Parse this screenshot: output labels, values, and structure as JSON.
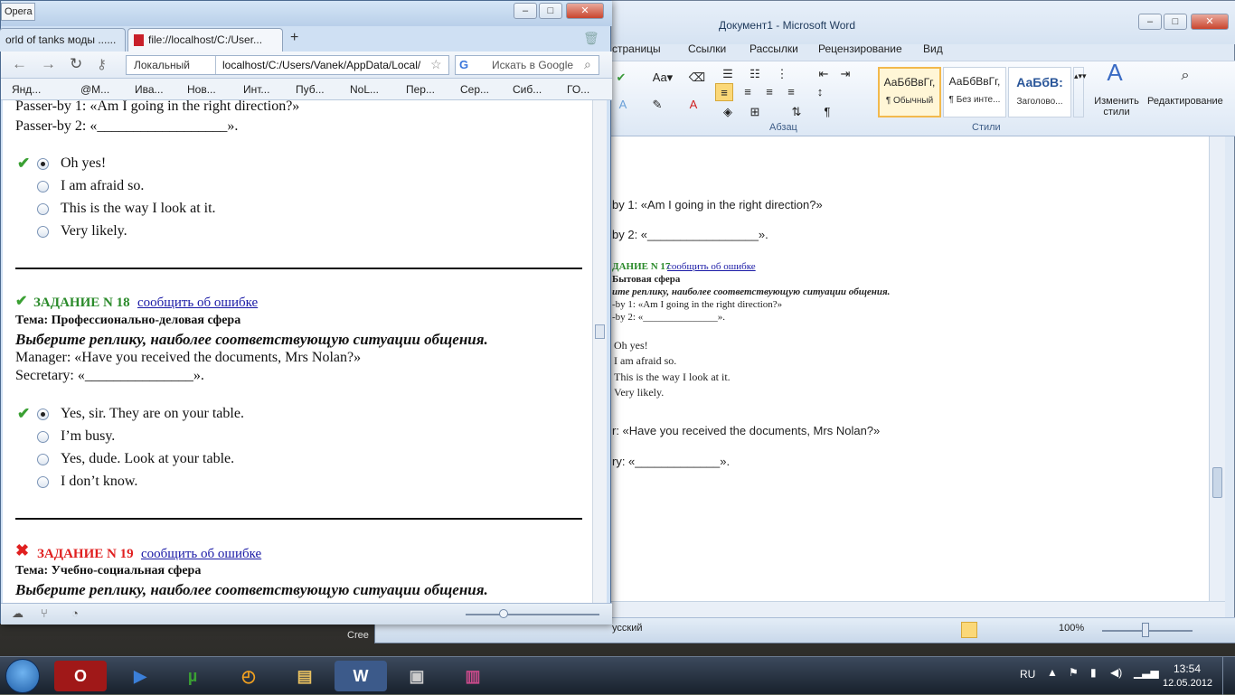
{
  "word": {
    "title": "Документ1 - Microsoft Word",
    "menu": [
      "страницы",
      "Ссылки",
      "Рассылки",
      "Рецензирование",
      "Вид"
    ],
    "styles": [
      {
        "preview": "АаБбВвГг,",
        "name": "¶ Обычный"
      },
      {
        "preview": "АаБбВвГг,",
        "name": "¶ Без инте..."
      },
      {
        "preview": "АаБбВ:",
        "name": "Заголово..."
      }
    ],
    "change_styles": "Изменить стили",
    "editing": "Редактирование",
    "group_paragraph": "Абзац",
    "group_styles": "Стили",
    "doc_lines": [
      "by 1: «Am I going in the right direction?»",
      "by 2: «_________________».",
      "ДАНИЕ N 17",
      "сообщить об ошибке",
      "Бытовая сфера",
      "ите реплику, наиболее соответствующую ситуации общения.",
      "-by 1: «Am I going in the right direction?»",
      "-by 2: «_______________».",
      "Oh yes!",
      "I am afraid so.",
      "This is the way I look at it.",
      "Very likely.",
      "r: «Have you received the documents, Mrs Nolan?»",
      "ry: «_____________»."
    ],
    "language": "усский",
    "zoom": "100%"
  },
  "opera": {
    "badge": "Opera",
    "tabs": [
      "orld of tanks моды ......",
      "file://localhost/C:/User..."
    ],
    "address_label": "Локальный",
    "address": "localhost/C:/Users/Vanek/AppData/Local/",
    "search_placeholder": "Искать в Google",
    "bookmarks": [
      "Янд...",
      "@M...",
      "Ива...",
      "Нов...",
      "Инт...",
      "Пуб...",
      "NoL...",
      "Пер...",
      "Сер...",
      "Сиб...",
      "ГО..."
    ]
  },
  "page": {
    "prev_q1": "Passer-by 1: «Am I going in the right direction?»",
    "prev_q2": "Passer-by 2: «__________________».",
    "prev_options": [
      "Oh yes!",
      "I am afraid so.",
      "This is the way I look at it.",
      "Very likely."
    ],
    "task18_title": "ЗАДАНИЕ N 18",
    "report_link": "сообщить об ошибке",
    "task18_topic": "Тема: Профессионально-деловая сфера",
    "instruction": "Выберите реплику, наиболее соответствующую ситуации общения.",
    "task18_line1": "Manager: «Have you received the documents, Mrs Nolan?»",
    "task18_line2": "Secretary: «_______________».",
    "task18_options": [
      "Yes, sir. They are on your table.",
      "I’m busy.",
      "Yes, dude. Look at your table.",
      "I don’t know."
    ],
    "task19_title": "ЗАДАНИЕ N 19",
    "task19_topic": "Тема: Учебно-социальная сфера",
    "task19_instruction": "Выберите реплику, наиболее соответствующую ситуации общения."
  },
  "taskbar": {
    "lang": "RU",
    "time": "13:54",
    "date": "12.05.2012",
    "behind_text": "Cree"
  },
  "colors": {
    "correct": "#3aa033",
    "wrong": "#e02020",
    "link": "#1a1aa6"
  }
}
